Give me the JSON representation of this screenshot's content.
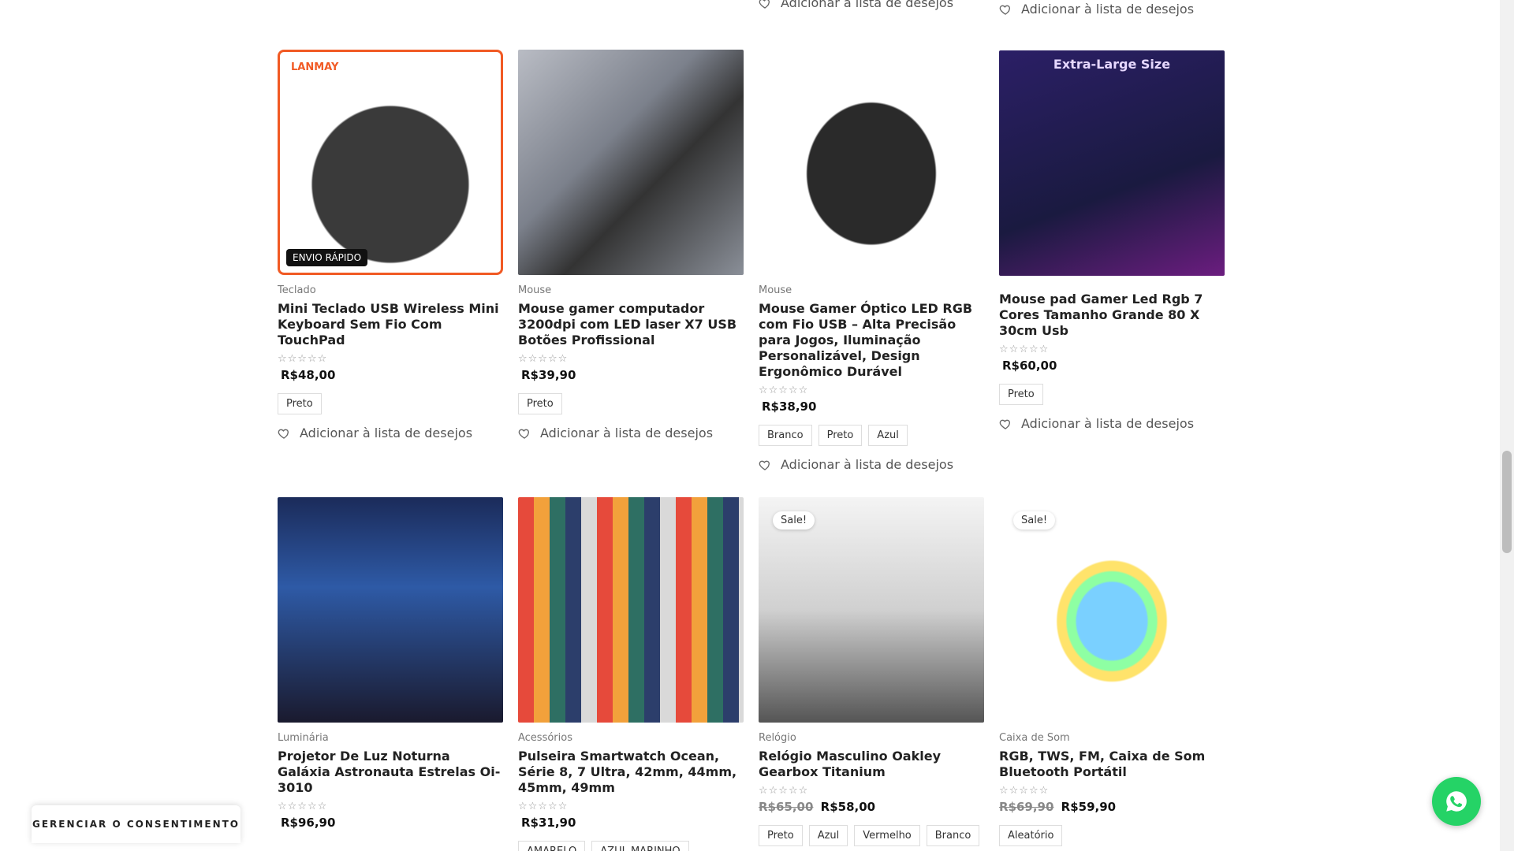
{
  "wishlist_label": "Adicionar à lista de desejos",
  "top_wish_cols": [
    {
      "id": 3,
      "label": "Adicionar à lista de desejos"
    },
    {
      "id": 4,
      "label": "Adicionar à lista de desejos"
    }
  ],
  "products": [
    {
      "category": "Teclado",
      "title": "Mini Teclado USB Wireless Mini Keyboard Sem Fio Com TouchPad",
      "rating": "☆☆☆☆☆",
      "price_old": "",
      "price": "R$48,00",
      "chips": [
        "Preto"
      ],
      "sale": "",
      "badge": "ENVIO RÁPIDO",
      "brand": "LANMAY"
    },
    {
      "category": "Mouse",
      "title": "Mouse gamer computador 3200dpi com LED laser X7 USB Botões Profissional",
      "rating": "☆☆☆☆☆",
      "price_old": "",
      "price": "R$39,90",
      "chips": [
        "Preto"
      ],
      "sale": ""
    },
    {
      "category": "Mouse",
      "title": "Mouse Gamer Óptico LED RGB com Fio USB – Alta Precisão para Jogos, Iluminação Personalizável, Design Ergonômico Durável",
      "rating": "☆☆☆☆☆",
      "price_old": "",
      "price": "R$38,90",
      "chips": [
        "Branco",
        "Preto",
        "Azul"
      ],
      "sale": ""
    },
    {
      "category": "",
      "title": "Mouse pad Gamer Led Rgb 7 Cores Tamanho Grande 80 X 30cm Usb",
      "rating": "☆☆☆☆☆",
      "price_old": "",
      "price": "R$60,00",
      "chips": [
        "Preto"
      ],
      "sale": "",
      "image_title": "Extra-Large Size"
    },
    {
      "category": "Luminária",
      "title": "Projetor De Luz Noturna Galáxia Astronauta Estrelas Oi-3010",
      "rating": "☆☆☆☆☆",
      "price_old": "",
      "price": "R$96,90",
      "chips": [],
      "sale": ""
    },
    {
      "category": "Acessórios",
      "title": "Pulseira Smartwatch Ocean, Série 8, 7 Ultra, 42mm, 44mm, 45mm, 49mm",
      "rating": "☆☆☆☆☆",
      "price_old": "",
      "price": "R$31,90",
      "chips": [
        "AMARELO",
        "AZUL MARINHO"
      ],
      "sale": ""
    },
    {
      "category": "Relógio",
      "title": "Relógio Masculino Oakley Gearbox Titanium",
      "rating": "☆☆☆☆☆",
      "price_old": "R$65,00",
      "price": "R$58,00",
      "chips": [
        "Preto",
        "Azul",
        "Vermelho",
        "Branco"
      ],
      "sale": "Sale!"
    },
    {
      "category": "Caixa de Som",
      "title": "RGB, TWS, FM, Caixa de Som Bluetooth Portátil",
      "rating": "☆☆☆☆☆",
      "price_old": "R$69,90",
      "price": "R$59,90",
      "chips": [
        "Aleatório"
      ],
      "sale": "Sale!"
    }
  ],
  "consent_label": "GERENCIAR O CONSENTIMENTO",
  "colors": {
    "accent": "#25D366",
    "keyboard_border": "#f15a24"
  },
  "icons": {
    "heart": "heart-icon",
    "whatsapp": "whatsapp-icon"
  }
}
